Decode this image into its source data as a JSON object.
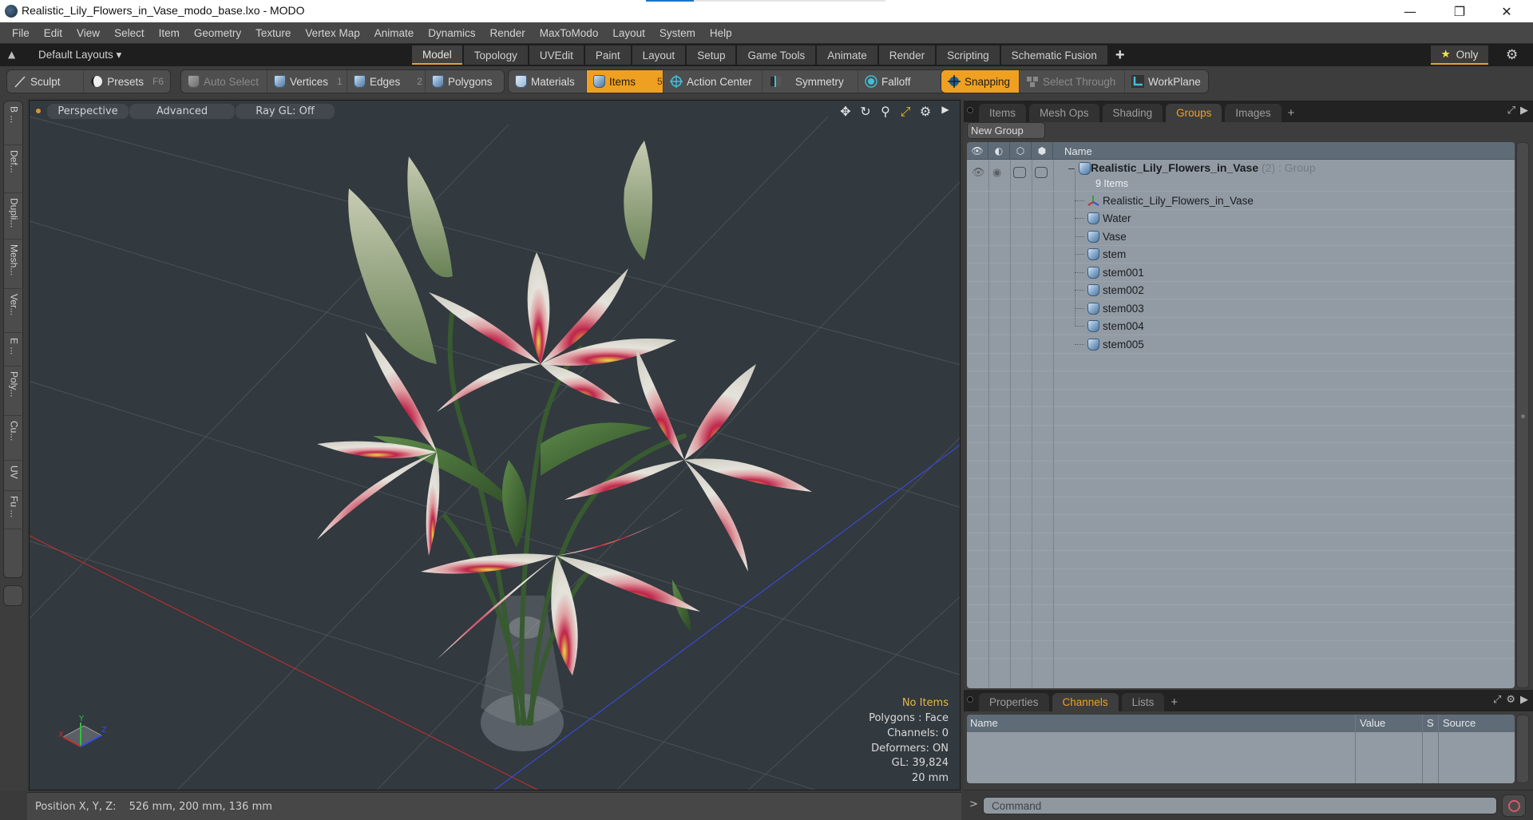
{
  "window": {
    "title": "Realistic_Lily_Flowers_in_Vase_modo_base.lxo - MODO",
    "progress_fraction": 0.2,
    "controls": {
      "minimize": "—",
      "maximize": "❐",
      "close": "✕"
    }
  },
  "menu": [
    "File",
    "Edit",
    "View",
    "Select",
    "Item",
    "Geometry",
    "Texture",
    "Vertex Map",
    "Animate",
    "Dynamics",
    "Render",
    "MaxToModo",
    "Layout",
    "System",
    "Help"
  ],
  "layout_bar": {
    "layouts_label": "Default Layouts ▾",
    "tabs": [
      {
        "label": "Model",
        "active": true
      },
      {
        "label": "Topology"
      },
      {
        "label": "UVEdit"
      },
      {
        "label": "Paint"
      },
      {
        "label": "Layout"
      },
      {
        "label": "Setup"
      },
      {
        "label": "Game Tools"
      },
      {
        "label": "Animate"
      },
      {
        "label": "Render"
      },
      {
        "label": "Scripting"
      },
      {
        "label": "Schematic Fusion"
      }
    ],
    "add_tab": "+",
    "only_label": "Only",
    "star_glyph": "★",
    "gear_glyph": "⚙"
  },
  "toolbar": {
    "sculpt": "Sculpt",
    "presets": "Presets",
    "presets_key": "F6",
    "auto_select": "Auto Select",
    "vertices": "Vertices",
    "vertices_key": "1",
    "edges": "Edges",
    "edges_key": "2",
    "polygons": "Polygons",
    "materials": "Materials",
    "items": "Items",
    "items_key": "5",
    "action_center": "Action Center",
    "symmetry": "Symmetry",
    "falloff": "Falloff",
    "snapping": "Snapping",
    "select_through": "Select Through",
    "workplane": "WorkPlane"
  },
  "left_strip": [
    "B ...",
    "Def...",
    "Dupli...",
    "Mesh...",
    "Ver...",
    "E ...",
    "Poly...",
    "Cu...",
    "UV",
    "Fu ..."
  ],
  "viewport": {
    "view_mode": "Perspective",
    "shading": "Advanced",
    "raygl": "Ray GL: Off",
    "info": {
      "selection": "No Items",
      "polygons": "Polygons : Face",
      "channels": "Channels: 0",
      "deformers": "Deformers: ON",
      "gl": "GL: 39,824",
      "grid": "20 mm"
    },
    "axis_labels": {
      "x": "X",
      "y": "Y",
      "z": "Z"
    }
  },
  "status": {
    "label": "Position X, Y, Z:",
    "value": "526 mm, 200 mm, 136 mm"
  },
  "right_panel": {
    "top_tabs": [
      {
        "label": "Items"
      },
      {
        "label": "Mesh Ops"
      },
      {
        "label": "Shading"
      },
      {
        "label": "Groups",
        "active": true
      },
      {
        "label": "Images"
      }
    ],
    "add_tab": "+",
    "new_group": "New Group",
    "groups_header": {
      "name": "Name"
    },
    "group": {
      "name": "Realistic_Lily_Flowers_in_Vase",
      "meta": "(2) : Group",
      "count": "9 Items",
      "items": [
        {
          "name": "Realistic_Lily_Flowers_in_Vase",
          "icon": "locator-icon"
        },
        {
          "name": "Water",
          "icon": "mesh-icon"
        },
        {
          "name": "Vase",
          "icon": "mesh-icon"
        },
        {
          "name": "stem",
          "icon": "mesh-icon"
        },
        {
          "name": "stem001",
          "icon": "mesh-icon"
        },
        {
          "name": "stem002",
          "icon": "mesh-icon"
        },
        {
          "name": "stem003",
          "icon": "mesh-icon"
        },
        {
          "name": "stem004",
          "icon": "mesh-icon"
        },
        {
          "name": "stem005",
          "icon": "mesh-icon"
        }
      ]
    },
    "bottom_tabs": [
      {
        "label": "Properties"
      },
      {
        "label": "Channels",
        "active": true
      },
      {
        "label": "Lists"
      }
    ],
    "channels_columns": [
      "Name",
      "Value",
      "S",
      "Source"
    ],
    "command_prompt": ">",
    "command_placeholder": "Command"
  },
  "colors": {
    "accent": "#f0a020",
    "viewport_bg": "#32393f",
    "list_bg": "#929ba4",
    "header_bg": "#5f6c78"
  }
}
